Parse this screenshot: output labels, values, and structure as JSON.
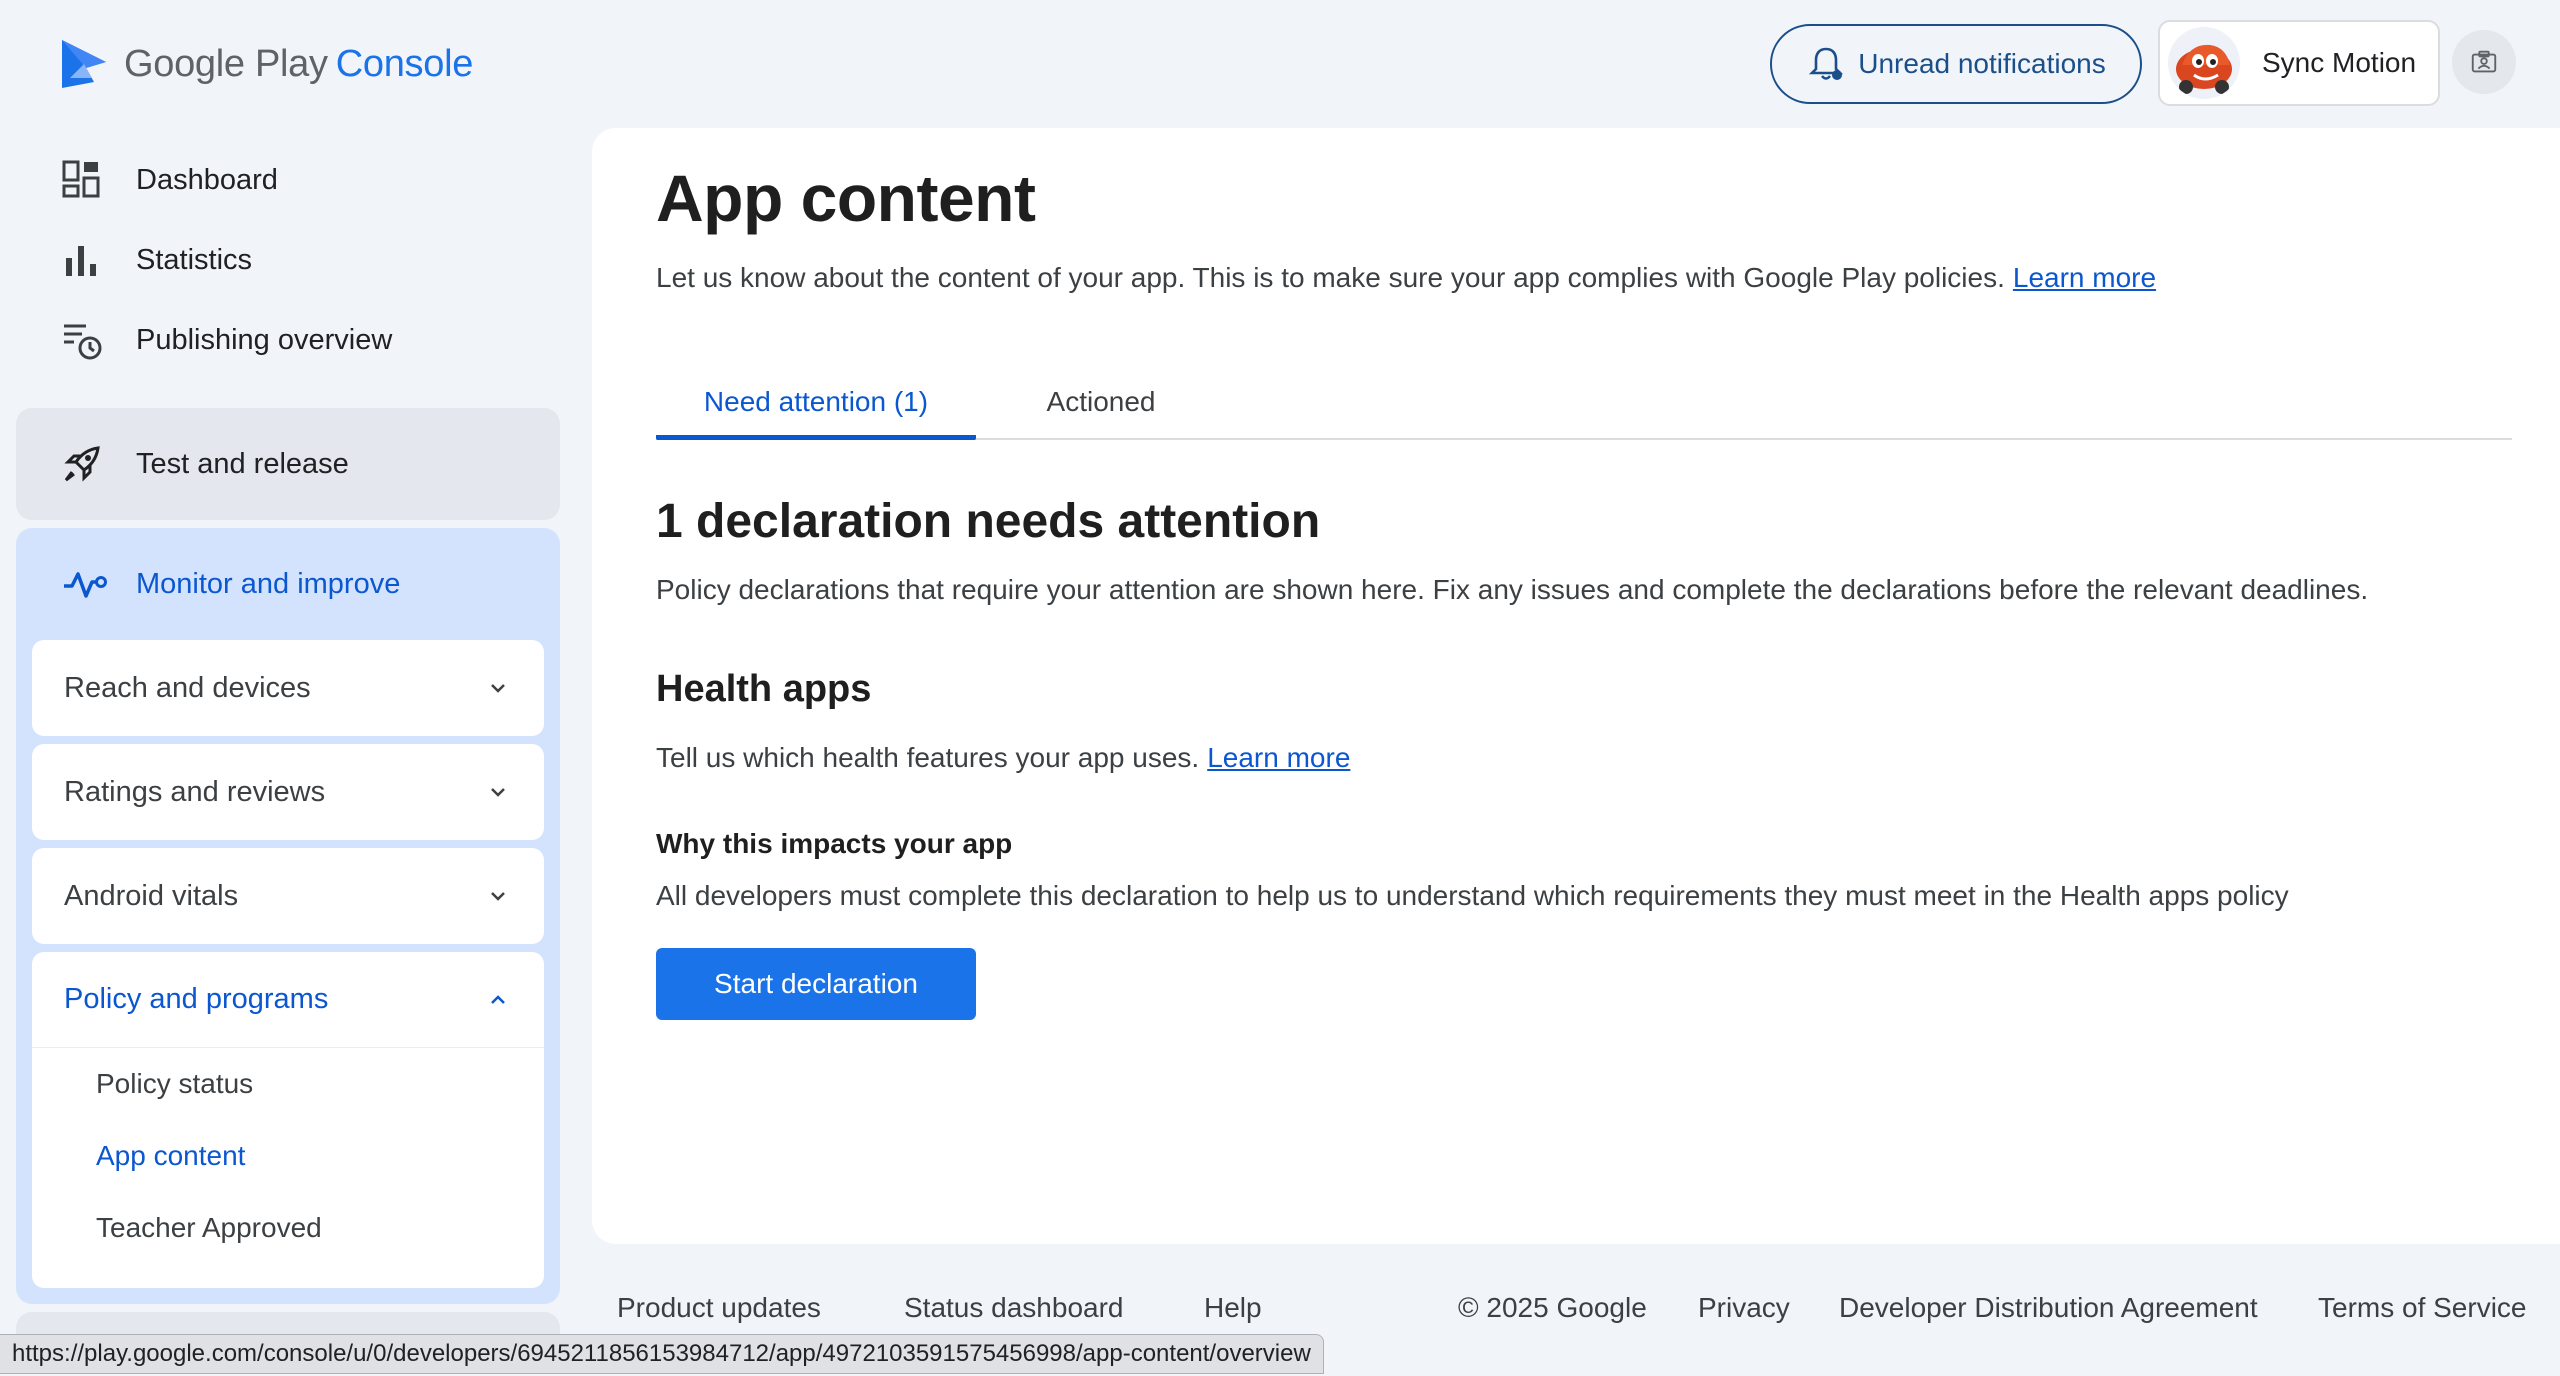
{
  "header": {
    "logo_google": "Google Play",
    "logo_console": "Console",
    "notifications_label": "Unread notifications",
    "account_name": "Sync Motion"
  },
  "sidebar": {
    "nav": [
      {
        "label": "Dashboard",
        "icon": "dashboard-icon"
      },
      {
        "label": "Statistics",
        "icon": "bar-chart-icon"
      },
      {
        "label": "Publishing overview",
        "icon": "publishing-overview-icon"
      }
    ],
    "test_release": "Test and release",
    "monitor_improve": "Monitor and improve",
    "sections": [
      {
        "label": "Reach and devices"
      },
      {
        "label": "Ratings and reviews"
      },
      {
        "label": "Android vitals"
      }
    ],
    "policy": {
      "label": "Policy and programs",
      "items": [
        {
          "label": "Policy status"
        },
        {
          "label": "App content"
        },
        {
          "label": "Teacher Approved"
        }
      ]
    }
  },
  "main": {
    "title": "App content",
    "description": "Let us know about the content of your app. This is to make sure your app complies with Google Play policies.",
    "learn_more": "Learn more",
    "tabs": [
      {
        "label": "Need attention (1)"
      },
      {
        "label": "Actioned"
      }
    ],
    "section_title": "1 declaration needs attention",
    "section_desc": "Policy declarations that require your attention are shown here. Fix any issues and complete the declarations before the relevant deadlines.",
    "health_title": "Health apps",
    "health_desc": "Tell us which health features your app uses.",
    "health_learn_more": "Learn more",
    "why_title": "Why this impacts your app",
    "why_desc": "All developers must complete this declaration to help us to understand which requirements they must meet in the Health apps policy",
    "start_button": "Start declaration"
  },
  "footer": {
    "product_updates": "Product updates",
    "status_dashboard": "Status dashboard",
    "help": "Help",
    "copyright": "© 2025 Google",
    "privacy": "Privacy",
    "dda": "Developer Distribution Agreement",
    "tos": "Terms of Service"
  },
  "status_url": "https://play.google.com/console/u/0/developers/6945211856153984712/app/4972103591575456998/app-content/overview",
  "colors": {
    "accent": "#0b57d0",
    "primary_button": "#1a73e8",
    "selected_group": "#d3e3fd",
    "background": "#f1f4f9"
  }
}
